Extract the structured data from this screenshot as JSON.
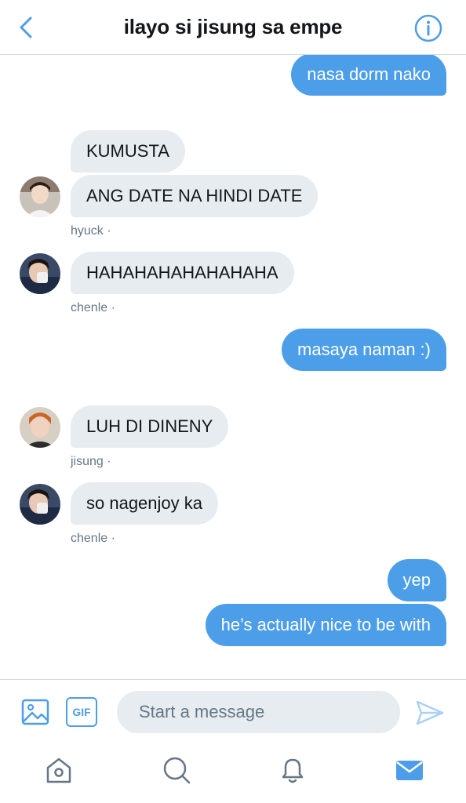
{
  "header": {
    "title": "ilayo si jisung sa empe",
    "back_icon": "chevron-left-icon",
    "info_icon": "info-icon"
  },
  "colors": {
    "accent": "#4d9ee9",
    "incoming_bubble": "#e6ecf0",
    "meta_text": "#657786"
  },
  "messages": [
    {
      "direction": "outgoing",
      "text": "nasa dorm nako"
    },
    {
      "direction": "incoming",
      "text": "KUMUSTA"
    },
    {
      "direction": "incoming",
      "text": "ANG DATE NA HINDI DATE",
      "sender": "hyuck ·"
    },
    {
      "direction": "incoming",
      "text": "HAHAHAHAHAHAHAHA",
      "sender": "chenle ·"
    },
    {
      "direction": "outgoing",
      "text": "masaya naman :)"
    },
    {
      "direction": "incoming",
      "text": "LUH DI DINENY",
      "sender": "jisung ·"
    },
    {
      "direction": "incoming",
      "text": "so nagenjoy ka",
      "sender": "chenle ·"
    },
    {
      "direction": "outgoing",
      "text": "yep"
    },
    {
      "direction": "outgoing",
      "text": "he’s actually nice to be with"
    }
  ],
  "composer": {
    "placeholder": "Start a message",
    "gif_label": "GIF",
    "media_icon": "image-icon",
    "send_icon": "send-icon"
  },
  "tabbar": {
    "items": [
      {
        "icon": "home-icon",
        "active": false
      },
      {
        "icon": "search-icon",
        "active": false
      },
      {
        "icon": "bell-icon",
        "active": false
      },
      {
        "icon": "mail-icon",
        "active": true
      }
    ]
  }
}
